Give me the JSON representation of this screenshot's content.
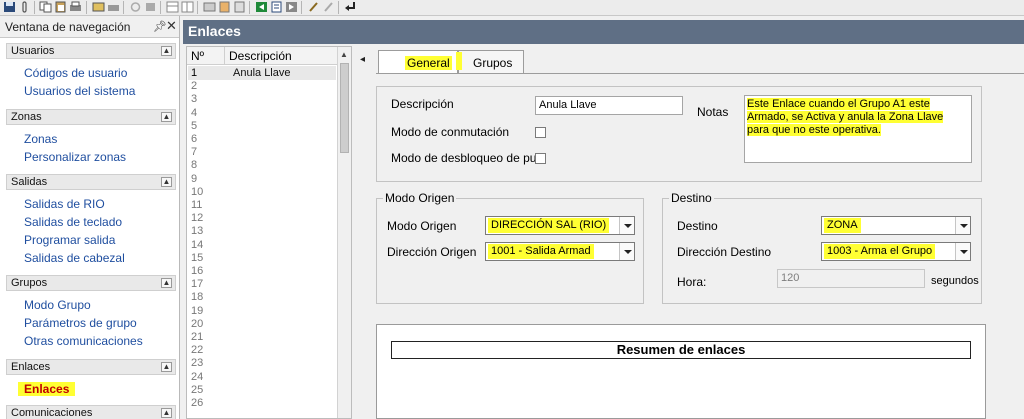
{
  "toolbar": {
    "icons": [
      "save-icon",
      "attach-icon",
      "copy-icon",
      "paste-icon",
      "print-icon",
      "find-icon",
      "connect-icon",
      "refresh-icon",
      "stop-icon",
      "table-icon",
      "grid-icon",
      "export-icon",
      "import-icon",
      "list-icon",
      "back-green-icon",
      "document-icon",
      "forward-icon",
      "tools-icon",
      "wand-icon",
      "enter-icon"
    ]
  },
  "nav": {
    "title": "Ventana de navegación",
    "pin": "⊓",
    "close": "✕",
    "groups": [
      {
        "label": "Usuarios",
        "items": [
          "Códigos de usuario",
          "Usuarios del sistema"
        ]
      },
      {
        "label": "Zonas",
        "items": [
          "Zonas",
          "Personalizar zonas"
        ]
      },
      {
        "label": "Salidas",
        "items": [
          "Salidas de RIO",
          "Salidas de teclado",
          "Programar salida",
          "Salidas de cabezal"
        ]
      },
      {
        "label": "Grupos",
        "items": [
          "Modo Grupo",
          "Parámetros de grupo",
          "Otras comunicaciones"
        ]
      },
      {
        "label": "Enlaces",
        "items": [
          "Enlaces"
        ]
      },
      {
        "label": "Comunicaciones",
        "items": []
      }
    ],
    "highlight_color": "#ffff33"
  },
  "main": {
    "title": "Enlaces",
    "header_color": "#5f6f85"
  },
  "list": {
    "col_no": "Nº",
    "col_desc": "Descripción",
    "rows": [
      "1",
      "2",
      "3",
      "4",
      "5",
      "6",
      "7",
      "8",
      "9",
      "10",
      "11",
      "12",
      "13",
      "14",
      "15",
      "16",
      "17",
      "18",
      "19",
      "20",
      "21",
      "22",
      "23",
      "24",
      "25",
      "26"
    ],
    "first_desc": "Anula Llave"
  },
  "tabs": {
    "arrow": "◂",
    "general": "General",
    "grupos": "Grupos"
  },
  "general": {
    "desc_label": "Descripción",
    "desc_value": "Anula Llave",
    "modo_conm_label": "Modo de conmutación",
    "modo_desb_label": "Modo de desbloqueo de pue",
    "notas_label": "Notas",
    "notas_value": "Este Enlace cuando el Grupo A1 este Armado, se Activa y anula la Zona Llave para que no este operativa."
  },
  "origen": {
    "legend": "Modo Origen",
    "modo_label": "Modo Origen",
    "modo_value": "DIRECCIÓN SAL (RIO)",
    "dir_label": "Dirección Origen",
    "dir_value": "1001 - Salida Armad"
  },
  "destino": {
    "legend": "Destino",
    "destino_label": "Destino",
    "destino_value": "ZONA",
    "dir_label": "Dirección Destino",
    "dir_value": "1003 - Arma el Grupo",
    "hora_label": "Hora:",
    "hora_value": "120",
    "segundos": "segundos"
  },
  "summary": {
    "title": "Resumen de enlaces"
  }
}
